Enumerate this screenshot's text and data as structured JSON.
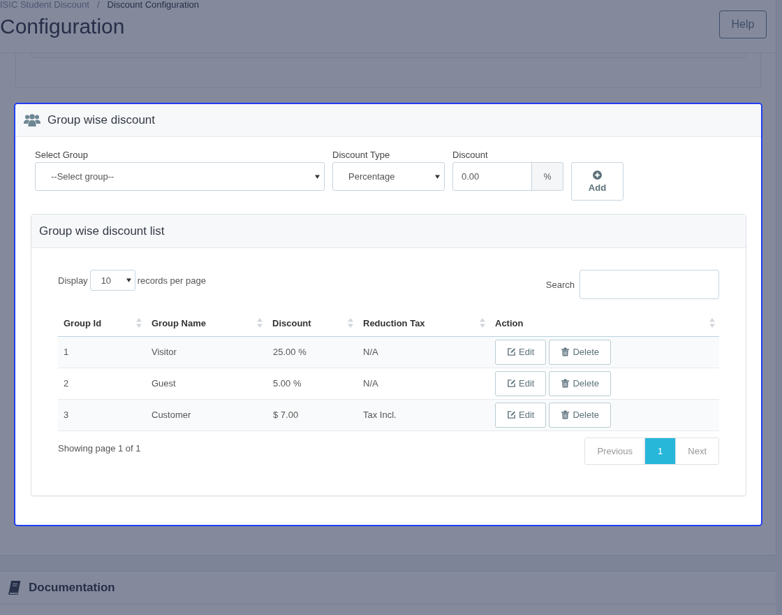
{
  "breadcrumb": {
    "items": [
      {
        "label": "ISIC Student Discount",
        "selected": false
      },
      {
        "label": "Discount Configuration",
        "selected": true
      }
    ],
    "separator": "/"
  },
  "page_title": "Configuration",
  "help_button": "Help",
  "group_discount_panel": {
    "title": "Group wise discount",
    "form": {
      "group_field": {
        "label": "Select Group",
        "value": "--Select group--"
      },
      "type_field": {
        "label": "Discount Type",
        "value": "Percentage"
      },
      "discount_field": {
        "label": "Discount",
        "value": "0.00",
        "addon": "%"
      },
      "add_button": "Add"
    },
    "list": {
      "title": "Group wise discount list",
      "length_prefix": "Display",
      "length_value": "10",
      "length_suffix": "records per page",
      "search_label": "Search",
      "columns": [
        "Group Id",
        "Group Name",
        "Discount",
        "Reduction Tax",
        "Action"
      ],
      "rows": [
        {
          "cells": [
            "1",
            "Visitor",
            "25.00 %",
            "N/A"
          ],
          "actions": [
            {
              "kind": "edit",
              "label": "Edit"
            },
            {
              "kind": "delete",
              "label": "Delete"
            }
          ]
        },
        {
          "cells": [
            "2",
            "Guest",
            "5.00 %",
            "N/A"
          ],
          "actions": [
            {
              "kind": "edit",
              "label": "Edit"
            },
            {
              "kind": "delete",
              "label": "Delete"
            }
          ]
        },
        {
          "cells": [
            "3",
            "Customer",
            "$ 7.00",
            "Tax Incl."
          ],
          "actions": [
            {
              "kind": "edit",
              "label": "Edit"
            },
            {
              "kind": "delete",
              "label": "Delete"
            }
          ]
        }
      ],
      "info": "Showing page 1 of 1",
      "pagination": [
        {
          "label": "Previous",
          "selected": false,
          "disabled": true
        },
        {
          "label": "1",
          "selected": true,
          "disabled": false
        },
        {
          "label": "Next",
          "selected": false,
          "disabled": true
        }
      ]
    }
  },
  "documentation": {
    "title": "Documentation"
  }
}
